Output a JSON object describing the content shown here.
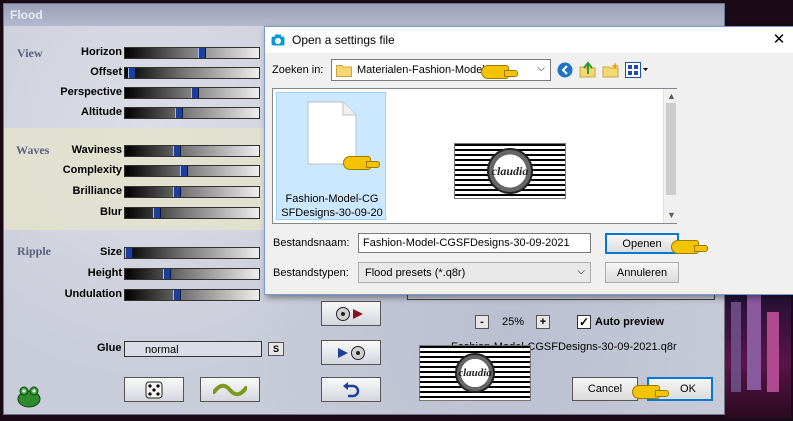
{
  "window": {
    "title": "Flood"
  },
  "sections": {
    "view": "View",
    "waves": "Waves",
    "ripple": "Ripple"
  },
  "params": [
    {
      "label": "Horizon",
      "value": 0.58
    },
    {
      "label": "Offset",
      "value": 0.02
    },
    {
      "label": "Perspective",
      "value": 0.52
    },
    {
      "label": "Altitude",
      "value": 0.4
    },
    {
      "label": "Waviness",
      "value": 0.38
    },
    {
      "label": "Complexity",
      "value": 0.44
    },
    {
      "label": "Brilliance",
      "value": 0.38
    },
    {
      "label": "Blur",
      "value": 0.22
    },
    {
      "label": "Size",
      "value": 0.0
    },
    {
      "label": "Height",
      "value": 0.3
    },
    {
      "label": "Undulation",
      "value": 0.38
    }
  ],
  "glue": {
    "label": "Glue",
    "value": "normal",
    "button": "S"
  },
  "zoom": {
    "value": "25%",
    "minus": "-",
    "plus": "+"
  },
  "auto_preview": {
    "label": "Auto preview",
    "checked": true
  },
  "preset_name": "Fashion-Model-CGSFDesigns-30-09-2021.q8r",
  "thumb_text": "claudia",
  "actions": {
    "cancel": "Cancel",
    "ok": "OK"
  },
  "dialog": {
    "title": "Open a settings file",
    "close": "✕",
    "look_in_label": "Zoeken in:",
    "look_in_value": "Materialen-Fashion-Model",
    "file_item": "Fashion-Model-CGSFDesigns-30-09-20",
    "file_item_line1": "Fashion-Model-CG",
    "file_item_line2": "SFDesigns-30-09-20",
    "filename_label": "Bestandsnaam:",
    "filename_value": "Fashion-Model-CGSFDesigns-30-09-2021",
    "filetype_label": "Bestandstypen:",
    "filetype_value": "Flood presets (*.q8r)",
    "open_button": "Openen",
    "cancel_button": "Annuleren"
  },
  "colors": {
    "accent": "#0078d7",
    "thumb": "#1b3f9a",
    "hand": "#f5c400",
    "waves_band": "#e4e2cc"
  }
}
